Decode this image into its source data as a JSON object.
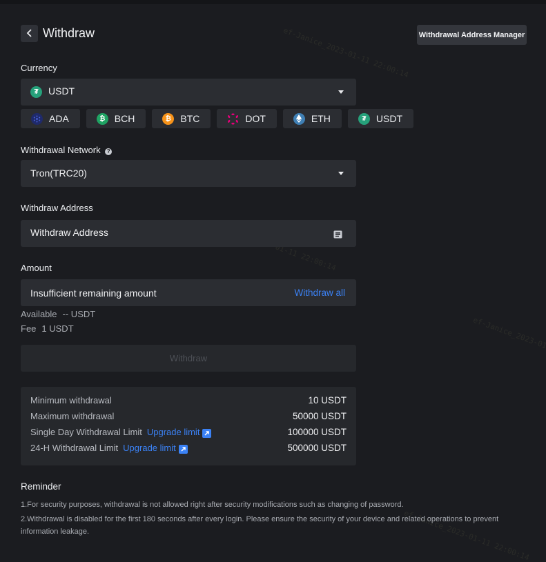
{
  "header": {
    "title": "Withdraw",
    "manager_button": "Withdrawal Address Manager"
  },
  "currency": {
    "label": "Currency",
    "selected": "USDT",
    "selected_icon": "tether-icon",
    "quick": [
      {
        "name": "ADA",
        "icon": "cardano-icon",
        "color": "#1f2a6b"
      },
      {
        "name": "BCH",
        "icon": "bitcoin-cash-icon",
        "color": "#1fa363"
      },
      {
        "name": "BTC",
        "icon": "bitcoin-icon",
        "color": "#f7931a"
      },
      {
        "name": "DOT",
        "icon": "polkadot-icon",
        "color": "#e6007a"
      },
      {
        "name": "ETH",
        "icon": "ethereum-icon",
        "color": "#3f7fb4"
      },
      {
        "name": "USDT",
        "icon": "tether-icon",
        "color": "#26a17b"
      }
    ]
  },
  "network": {
    "label": "Withdrawal Network",
    "selected": "Tron(TRC20)"
  },
  "address": {
    "label": "Withdraw Address",
    "placeholder": "Withdraw Address"
  },
  "amount": {
    "label": "Amount",
    "placeholder": "Insufficient remaining amount",
    "withdraw_all": "Withdraw all",
    "available_label": "Available",
    "available_value": "-- USDT",
    "fee_label": "Fee",
    "fee_value": "1 USDT"
  },
  "withdraw_button": "Withdraw",
  "limits": [
    {
      "label": "Minimum withdrawal",
      "value": "10 USDT",
      "link": ""
    },
    {
      "label": "Maximum withdrawal",
      "value": "50000 USDT",
      "link": ""
    },
    {
      "label": "Single Day Withdrawal Limit",
      "value": "100000 USDT",
      "link": "Upgrade limit"
    },
    {
      "label": "24-H Withdrawal Limit",
      "value": "500000 USDT",
      "link": "Upgrade limit"
    }
  ],
  "reminder": {
    "title": "Reminder",
    "lines": [
      "1.For security purposes, withdrawal is not allowed right after security modifications such as changing of password.",
      "2.Withdrawal is disabled for the first 180 seconds after every login. Please ensure the security of your device and related operations to prevent information leakage."
    ]
  },
  "watermark": "ef-Janice_2023-01-11 22:00:14"
}
